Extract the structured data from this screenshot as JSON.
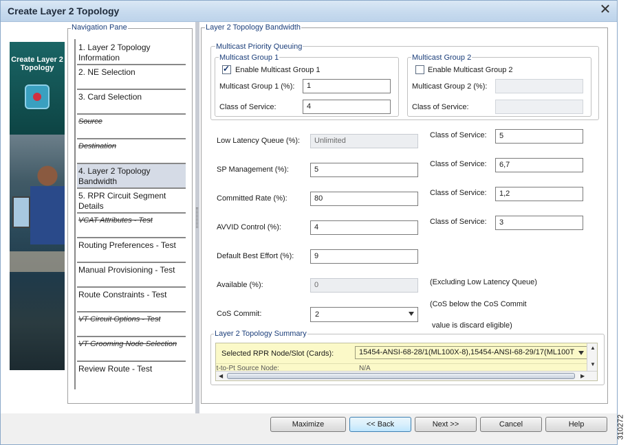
{
  "window": {
    "title": "Create Layer 2 Topology",
    "close_glyph": "✕"
  },
  "banner": {
    "label": "Create Layer 2 Topology"
  },
  "nav": {
    "group_label": "Navigation Pane",
    "items": [
      {
        "label": "1. Layer 2 Topology Information",
        "state": "normal"
      },
      {
        "label": "2. NE Selection",
        "state": "normal"
      },
      {
        "label": "3. Card Selection",
        "state": "normal"
      },
      {
        "label": "Source",
        "state": "disabled"
      },
      {
        "label": "Destination",
        "state": "disabled"
      },
      {
        "label": "4. Layer 2 Topology Bandwidth",
        "state": "active"
      },
      {
        "label": "5. RPR Circuit Segment Details",
        "state": "normal"
      },
      {
        "label": "VCAT Attributes - Test",
        "state": "disabled"
      },
      {
        "label": "Routing Preferences - Test",
        "state": "normal"
      },
      {
        "label": "Manual Provisioning - Test",
        "state": "normal"
      },
      {
        "label": "Route Constraints - Test",
        "state": "normal"
      },
      {
        "label": "VT Circuit Options - Test",
        "state": "disabled"
      },
      {
        "label": "VT Grooming Node Selection",
        "state": "disabled"
      },
      {
        "label": "Review Route - Test",
        "state": "normal"
      }
    ]
  },
  "bandwidth": {
    "group_label": "Layer 2 Topology Bandwidth",
    "mpq": {
      "group_label": "Multicast Priority Queuing",
      "group1": {
        "label": "Multicast Group 1",
        "enable_label": "Enable Multicast Group 1",
        "enabled": true,
        "pct_label": "Multicast Group 1 (%):",
        "pct_value": "1",
        "cos_label": "Class of Service:",
        "cos_value": "4"
      },
      "group2": {
        "label": "Multicast Group 2",
        "enable_label": "Enable Multicast Group 2",
        "enabled": false,
        "pct_label": "Multicast Group 2 (%):",
        "pct_value": "",
        "cos_label": "Class of Service:",
        "cos_value": ""
      }
    },
    "llq": {
      "label": "Low Latency Queue (%):",
      "value": "Unlimited",
      "cos_label": "Class of Service:",
      "cos_value": "5"
    },
    "spm": {
      "label": "SP Management (%):",
      "value": "5",
      "cos_label": "Class of Service:",
      "cos_value": "6,7"
    },
    "committed": {
      "label": "Committed Rate (%):",
      "value": "80",
      "cos_label": "Class of Service:",
      "cos_value": "1,2"
    },
    "avvid": {
      "label": "AVVID Control (%):",
      "value": "4",
      "cos_label": "Class of Service:",
      "cos_value": "3"
    },
    "dbe": {
      "label": "Default Best Effort (%):",
      "value": "9"
    },
    "available": {
      "label": "Available (%):",
      "value": "0",
      "note": "(Excluding Low Latency Queue)"
    },
    "cos_commit": {
      "label": "CoS Commit:",
      "value": "2",
      "note1": "(CoS below the CoS Commit",
      "note2": "value is discard eligible)"
    }
  },
  "summary": {
    "group_label": "Layer 2 Topology Summary",
    "row1_label": "Selected RPR Node/Slot (Cards):",
    "row1_value": "15454-ANSI-68-28/1(ML100X-8),15454-ANSI-68-29/17(ML100T",
    "row2_label": "Pt-to-Pt Source Node:",
    "row2_value": "N/A"
  },
  "buttons": {
    "maximize": "Maximize",
    "back": "<< Back",
    "next": "Next >>",
    "cancel": "Cancel",
    "help": "Help"
  },
  "figure_number": "310272"
}
